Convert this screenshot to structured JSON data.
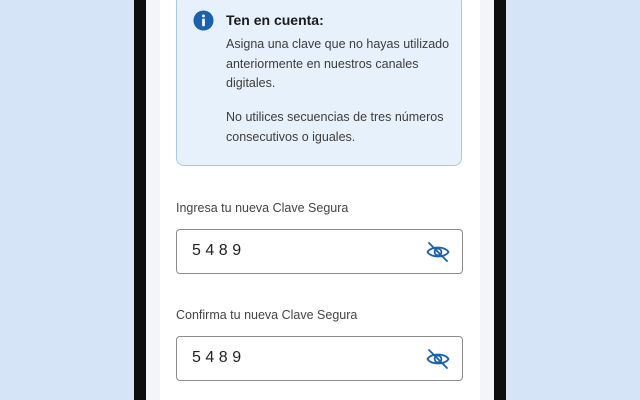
{
  "notice": {
    "title": "Ten en cuenta:",
    "paragraph_1": "Asigna una clave que no hayas utilizado anteriormente en nuestros canales digitales.",
    "paragraph_2": "No utilices secuencias de tres números consecutivos o iguales."
  },
  "new_password": {
    "label": "Ingresa tu nueva Clave Segura",
    "value": "5489",
    "toggle_icon": "eye-slash-icon"
  },
  "confirm_password": {
    "label": "Confirma tu nueva Clave Segura",
    "value": "5489",
    "toggle_icon": "eye-slash-icon"
  },
  "colors": {
    "accent": "#1b62ad",
    "info_background": "#e7f1fb",
    "info_border": "#a9c8e8",
    "page_background": "#d5e5f7"
  }
}
